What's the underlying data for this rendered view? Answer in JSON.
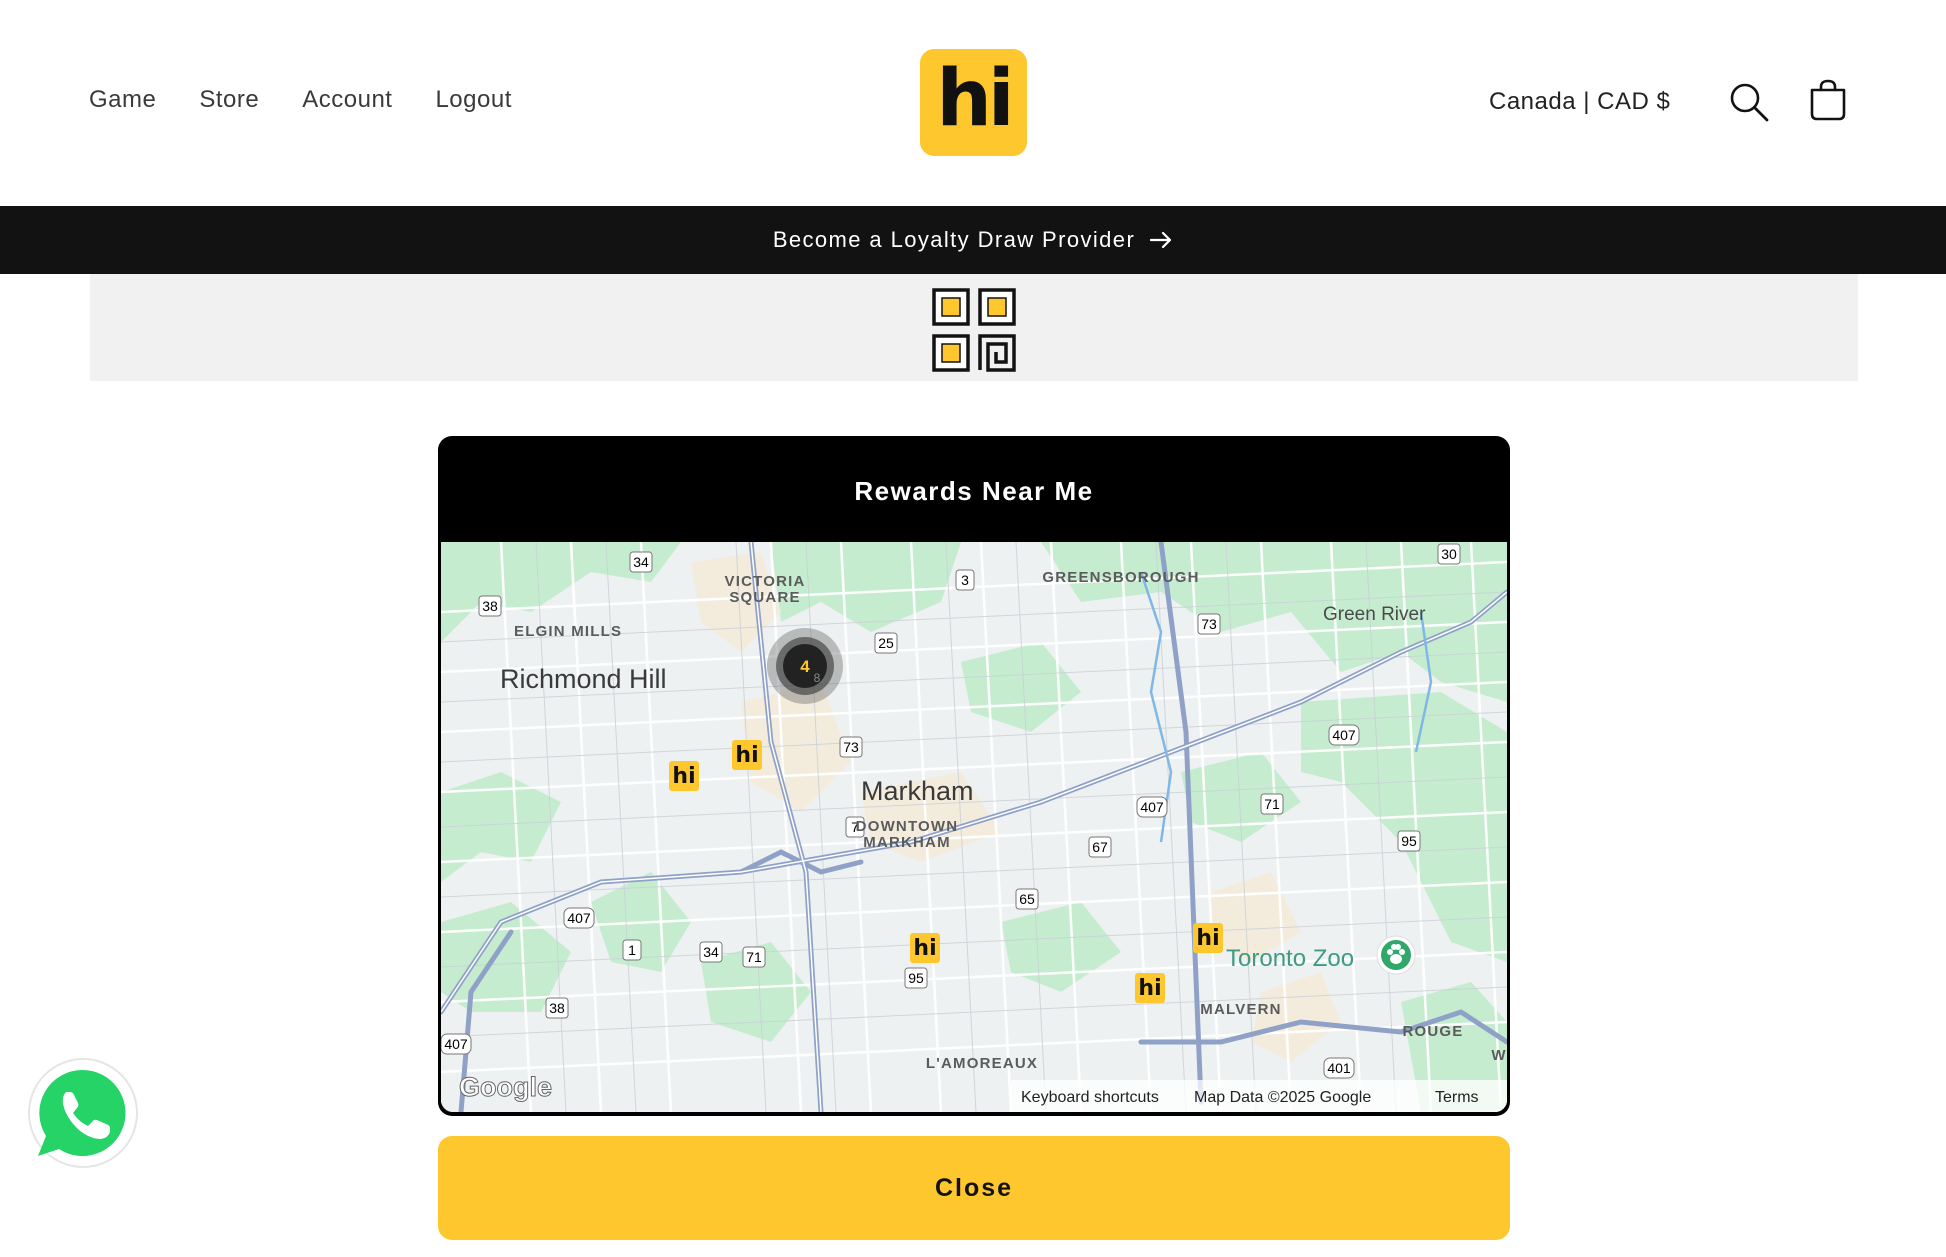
{
  "header": {
    "nav": [
      {
        "label": "Game"
      },
      {
        "label": "Store"
      },
      {
        "label": "Account"
      },
      {
        "label": "Logout"
      }
    ],
    "logo_text": "hi",
    "country": "Canada | CAD $"
  },
  "announcement": {
    "text": "Become a Loyalty Draw Provider"
  },
  "modal": {
    "title": "Rewards Near Me",
    "close_label": "Close"
  },
  "map": {
    "places": {
      "victoria_square_1": "VICTORIA",
      "victoria_square_2": "SQUARE",
      "greensborough": "GREENSBOROUGH",
      "green_river": "Green River",
      "elgin_mills": "ELGIN MILLS",
      "richmond_hill": "Richmond Hill",
      "markham": "Markham",
      "downtown_markham_1": "DOWNTOWN",
      "downtown_markham_2": "MARKHAM",
      "toronto_zoo": "Toronto Zoo",
      "malvern": "MALVERN",
      "rouge": "ROUGE",
      "lamoureaux": "L'AMOREAUX",
      "w": "W"
    },
    "highway_shields": [
      "34",
      "38",
      "3",
      "30",
      "73",
      "25",
      "73",
      "407",
      "7",
      "407",
      "71",
      "67",
      "95",
      "65",
      "407",
      "1",
      "34",
      "71",
      "38",
      "95",
      "407",
      "401"
    ],
    "cluster_count": "4",
    "cluster_sub": "8",
    "marker_label": "hi",
    "attribution": {
      "logo": "Google",
      "shortcuts": "Keyboard shortcuts",
      "data": "Map Data ©2025 Google",
      "terms": "Terms"
    }
  },
  "colors": {
    "brand_yellow": "#fec72e",
    "black": "#000000",
    "map_green": "#bfe8c8"
  }
}
